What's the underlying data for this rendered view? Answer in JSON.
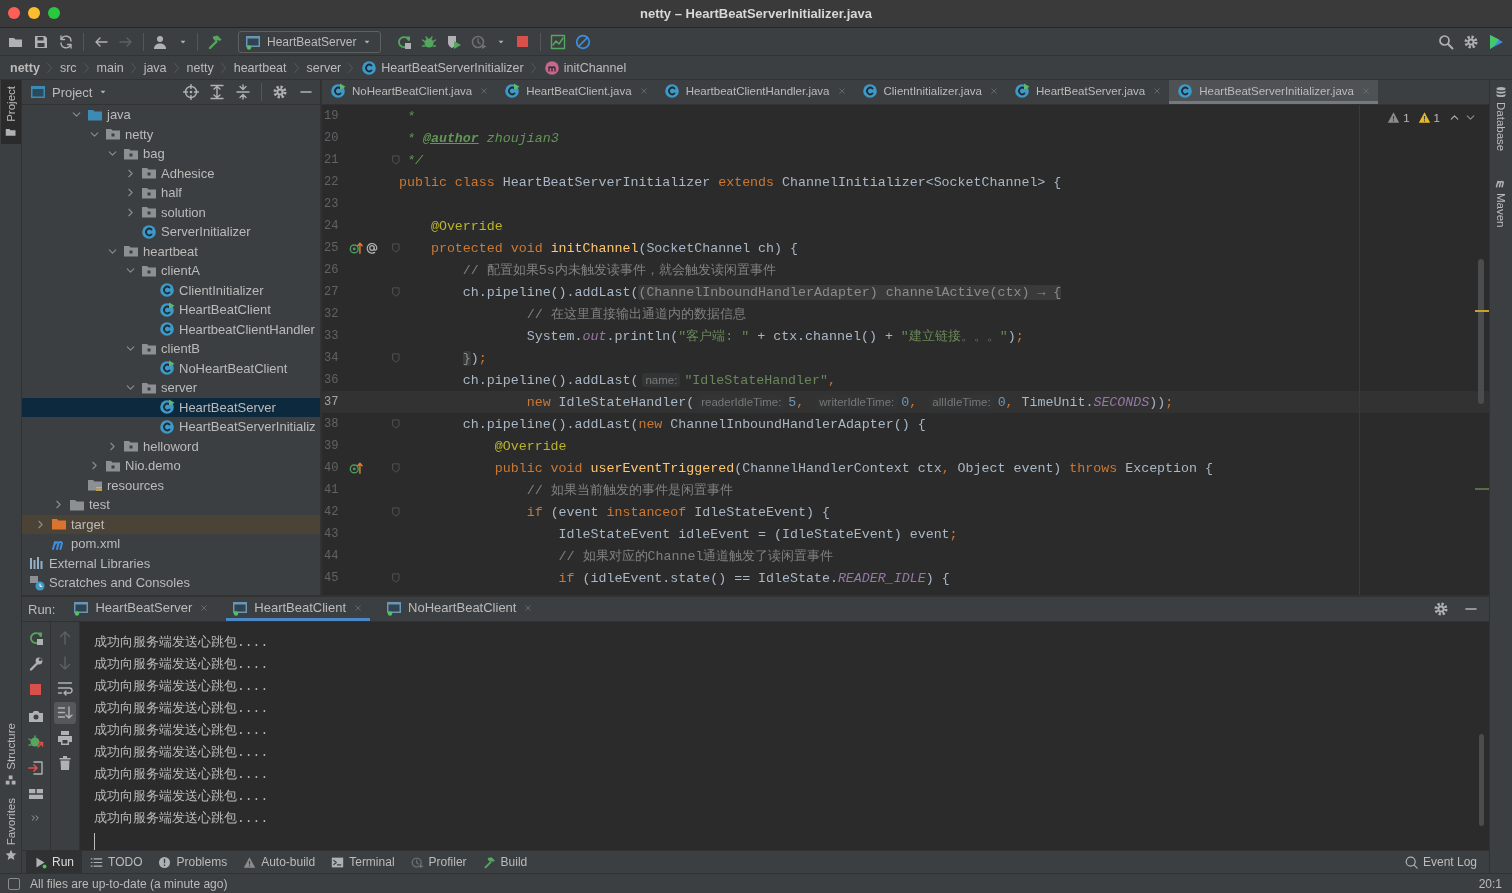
{
  "window": {
    "title": "netty – HeartBeatServerInitializer.java"
  },
  "toolbar": {
    "run_config": "HeartBeatServer"
  },
  "breadcrumbs": [
    {
      "label": "netty",
      "kind": "project"
    },
    {
      "label": "src",
      "kind": "folder"
    },
    {
      "label": "main",
      "kind": "folder"
    },
    {
      "label": "java",
      "kind": "folder"
    },
    {
      "label": "netty",
      "kind": "folder"
    },
    {
      "label": "heartbeat",
      "kind": "folder"
    },
    {
      "label": "server",
      "kind": "folder"
    },
    {
      "label": "HeartBeatServerInitializer",
      "kind": "class"
    },
    {
      "label": "initChannel",
      "kind": "method"
    }
  ],
  "left_stripe": [
    {
      "label": "Project",
      "kind": "project",
      "selected": true
    },
    {
      "label": "Structure",
      "kind": "structure",
      "selected": false
    },
    {
      "label": "Favorites",
      "kind": "favorites",
      "selected": false
    }
  ],
  "right_stripe": [
    {
      "label": "Database",
      "kind": "database"
    },
    {
      "label": "Maven",
      "kind": "maven"
    }
  ],
  "project_panel": {
    "title": "Project",
    "tree": [
      {
        "children": [
          {
            "children": [
              {
                "children": [
                  {
                    "label": "java",
                    "kind": "source-folder",
                    "expanded": true,
                    "selected": false,
                    "children": [
                      {
                        "label": "netty",
                        "kind": "package",
                        "expanded": true,
                        "selected": false,
                        "children": [
                          {
                            "label": "bag",
                            "kind": "package",
                            "expanded": true,
                            "selected": false,
                            "children": [
                              {
                                "label": "Adhesice",
                                "kind": "package",
                                "expanded": false,
                                "selected": false
                              },
                              {
                                "label": "half",
                                "kind": "package",
                                "expanded": false,
                                "selected": false
                              },
                              {
                                "label": "solution",
                                "kind": "package",
                                "expanded": false,
                                "selected": false
                              },
                              {
                                "label": "ServerInitializer",
                                "kind": "class",
                                "selected": false
                              }
                            ]
                          },
                          {
                            "label": "heartbeat",
                            "kind": "package",
                            "expanded": true,
                            "selected": false,
                            "children": [
                              {
                                "label": "clientA",
                                "kind": "package",
                                "expanded": true,
                                "selected": false,
                                "children": [
                                  {
                                    "label": "ClientInitializer",
                                    "kind": "class",
                                    "selected": false
                                  },
                                  {
                                    "label": "HeartBeatClient",
                                    "kind": "runnable-class",
                                    "selected": false
                                  },
                                  {
                                    "label": "HeartbeatClientHandler",
                                    "kind": "class",
                                    "selected": false
                                  }
                                ]
                              },
                              {
                                "label": "clientB",
                                "kind": "package",
                                "expanded": true,
                                "selected": false,
                                "children": [
                                  {
                                    "label": "NoHeartBeatClient",
                                    "kind": "runnable-class",
                                    "selected": false
                                  }
                                ]
                              },
                              {
                                "label": "server",
                                "kind": "package",
                                "expanded": true,
                                "selected": false,
                                "children": [
                                  {
                                    "label": "HeartBeatServer",
                                    "kind": "runnable-class",
                                    "selected": true
                                  },
                                  {
                                    "label": "HeartBeatServerInitializ",
                                    "kind": "class",
                                    "selected": false
                                  }
                                ]
                              }
                            ]
                          },
                          {
                            "label": "helloword",
                            "kind": "package",
                            "expanded": false,
                            "selected": false
                          }
                        ]
                      },
                      {
                        "label": "Nio.demo",
                        "kind": "package",
                        "expanded": false,
                        "selected": false
                      }
                    ]
                  },
                  {
                    "label": "resources",
                    "kind": "resources",
                    "selected": false
                  }
                ]
              },
              {
                "label": "test",
                "kind": "folder",
                "expanded": false,
                "selected": false
              }
            ]
          },
          {
            "label": "target",
            "kind": "excluded-folder",
            "expanded": false,
            "selected": false
          },
          {
            "label": "pom.xml",
            "kind": "maven",
            "selected": false
          }
        ]
      },
      {
        "label": "External Libraries",
        "kind": "libraries",
        "selected": false
      },
      {
        "label": "Scratches and Consoles",
        "kind": "scratches",
        "selected": false
      }
    ]
  },
  "editor": {
    "tabs": [
      {
        "label": "NoHeartBeatClient.java",
        "kind": "runnable-class",
        "selected": false
      },
      {
        "label": "HeartBeatClient.java",
        "kind": "runnable-class",
        "selected": false
      },
      {
        "label": "HeartbeatClientHandler.java",
        "kind": "class",
        "selected": false
      },
      {
        "label": "ClientInitializer.java",
        "kind": "class",
        "selected": false
      },
      {
        "label": "HeartBeatServer.java",
        "kind": "runnable-class",
        "selected": false
      },
      {
        "label": "HeartBeatServerInitializer.java",
        "kind": "class",
        "selected": true
      }
    ],
    "inspections": [
      {
        "kind": "weak-warning",
        "count": "1"
      },
      {
        "kind": "warning",
        "count": "1"
      }
    ],
    "lines": [
      {
        "number": "19",
        "current": false,
        "fold": false,
        "tokens": [
          {
            "kind": "doc",
            "text": " *"
          }
        ]
      },
      {
        "number": "20",
        "current": false,
        "fold": false,
        "tokens": [
          {
            "kind": "doc",
            "text": " * "
          },
          {
            "kind": "doctag",
            "text": "@author"
          },
          {
            "kind": "doc",
            "text": " zhoujian3"
          }
        ]
      },
      {
        "number": "21",
        "current": false,
        "fold": true,
        "tokens": [
          {
            "kind": "doc",
            "text": " */"
          }
        ]
      },
      {
        "number": "22",
        "current": false,
        "fold": false,
        "tokens": [
          {
            "kind": "keyword",
            "text": "public class "
          },
          {
            "kind": "plain",
            "text": "HeartBeatServerInitializer "
          },
          {
            "kind": "keyword",
            "text": "extends "
          },
          {
            "kind": "plain",
            "text": "ChannelInitializer<SocketChannel> {"
          }
        ]
      },
      {
        "number": "23",
        "current": false,
        "fold": false
      },
      {
        "number": "24",
        "current": false,
        "fold": false,
        "tokens": [
          {
            "kind": "annotation",
            "text": "    @Override"
          }
        ]
      },
      {
        "number": "25",
        "current": false,
        "fold": true,
        "overrides": true,
        "annotated": true,
        "tokens": [
          {
            "kind": "keyword",
            "text": "    protected void "
          },
          {
            "kind": "method",
            "text": "initChannel"
          },
          {
            "kind": "plain",
            "text": "(SocketChannel ch) {"
          }
        ]
      },
      {
        "number": "26",
        "current": false,
        "fold": false,
        "tokens": [
          {
            "kind": "comment",
            "text": "        // 配置如果5s内未触发读事件，就会触发读闲置事件"
          }
        ]
      },
      {
        "number": "27",
        "current": false,
        "fold": true,
        "tokens": [
          {
            "kind": "plain",
            "text": "        ch.pipeline().addLast("
          },
          {
            "kind": "folded",
            "text": "(ChannelInboundHandlerAdapter) channelActive(ctx) → {"
          }
        ]
      },
      {
        "number": "32",
        "current": false,
        "fold": false,
        "tokens": [
          {
            "kind": "comment",
            "text": "                // 在这里直接输出通道内的数据信息"
          }
        ]
      },
      {
        "number": "33",
        "current": false,
        "fold": false,
        "tokens": [
          {
            "kind": "plain",
            "text": "                System."
          },
          {
            "kind": "static",
            "text": "out"
          },
          {
            "kind": "plain",
            "text": ".println("
          },
          {
            "kind": "string",
            "text": "\"客户端: \""
          },
          {
            "kind": "plain",
            "text": " + ctx.channel() + "
          },
          {
            "kind": "string",
            "text": "\"建立链接。。。\""
          },
          {
            "kind": "plain",
            "text": ")"
          },
          {
            "kind": "keyword",
            "text": ";"
          }
        ]
      },
      {
        "number": "34",
        "current": false,
        "fold": true,
        "tokens": [
          {
            "kind": "folded",
            "text": "        }"
          },
          {
            "kind": "plain",
            "text": ")"
          },
          {
            "kind": "keyword",
            "text": ";"
          }
        ]
      },
      {
        "number": "36",
        "current": false,
        "fold": false,
        "tokens": [
          {
            "kind": "plain",
            "text": "        ch.pipeline().addLast("
          },
          {
            "kind": "hint",
            "text": "name:"
          },
          {
            "kind": "string",
            "text": "\"IdleStateHandler\""
          },
          {
            "kind": "keyword",
            "text": ","
          }
        ]
      },
      {
        "number": "37",
        "current": true,
        "fold": false,
        "tokens": [
          {
            "kind": "keyword",
            "text": "                new "
          },
          {
            "kind": "plain",
            "text": "IdleStateHandler("
          },
          {
            "kind": "hint",
            "text": "readerIdleTime:"
          },
          {
            "kind": "number",
            "text": "5"
          },
          {
            "kind": "keyword",
            "text": ", "
          },
          {
            "kind": "hint",
            "text": "writerIdleTime:"
          },
          {
            "kind": "number",
            "text": "0"
          },
          {
            "kind": "keyword",
            "text": ", "
          },
          {
            "kind": "hint",
            "text": "allIdleTime:"
          },
          {
            "kind": "number",
            "text": "0"
          },
          {
            "kind": "keyword",
            "text": ", "
          },
          {
            "kind": "plain",
            "text": "TimeUnit."
          },
          {
            "kind": "static",
            "text": "SECONDS"
          },
          {
            "kind": "plain",
            "text": "))"
          },
          {
            "kind": "keyword",
            "text": ";"
          }
        ]
      },
      {
        "number": "38",
        "current": false,
        "fold": true,
        "tokens": [
          {
            "kind": "plain",
            "text": "        ch.pipeline().addLast("
          },
          {
            "kind": "keyword",
            "text": "new "
          },
          {
            "kind": "plain",
            "text": "ChannelInboundHandlerAdapter() {"
          }
        ]
      },
      {
        "number": "39",
        "current": false,
        "fold": false,
        "tokens": [
          {
            "kind": "annotation",
            "text": "            @Override"
          }
        ]
      },
      {
        "number": "40",
        "current": false,
        "fold": true,
        "overrides": true,
        "annotated": false,
        "tokens": [
          {
            "kind": "keyword",
            "text": "            public void "
          },
          {
            "kind": "method",
            "text": "userEventTriggered"
          },
          {
            "kind": "plain",
            "text": "(ChannelHandlerContext ctx"
          },
          {
            "kind": "keyword",
            "text": ", "
          },
          {
            "kind": "plain",
            "text": "Object event) "
          },
          {
            "kind": "keyword",
            "text": "throws "
          },
          {
            "kind": "plain",
            "text": "Exception {"
          }
        ]
      },
      {
        "number": "41",
        "current": false,
        "fold": false,
        "tokens": [
          {
            "kind": "comment",
            "text": "                // 如果当前触发的事件是闲置事件"
          }
        ]
      },
      {
        "number": "42",
        "current": false,
        "fold": true,
        "tokens": [
          {
            "kind": "keyword",
            "text": "                if "
          },
          {
            "kind": "plain",
            "text": "(event "
          },
          {
            "kind": "keyword",
            "text": "instanceof "
          },
          {
            "kind": "plain",
            "text": "IdleStateEvent) {"
          }
        ]
      },
      {
        "number": "43",
        "current": false,
        "fold": false,
        "tokens": [
          {
            "kind": "plain",
            "text": "                    IdleStateEvent idleEvent = (IdleStateEvent) event"
          },
          {
            "kind": "keyword",
            "text": ";"
          }
        ]
      },
      {
        "number": "44",
        "current": false,
        "fold": false,
        "tokens": [
          {
            "kind": "comment",
            "text": "                    // 如果对应的Channel通道触发了读闲置事件"
          }
        ]
      },
      {
        "number": "45",
        "current": false,
        "fold": true,
        "tokens": [
          {
            "kind": "keyword",
            "text": "                    if "
          },
          {
            "kind": "plain",
            "text": "(idleEvent.state() == IdleState."
          },
          {
            "kind": "static",
            "text": "READER_IDLE"
          },
          {
            "kind": "plain",
            "text": ") {"
          }
        ]
      }
    ]
  },
  "run_panel": {
    "label": "Run:",
    "tabs": [
      {
        "label": "HeartBeatServer",
        "selected": false
      },
      {
        "label": "HeartBeatClient",
        "selected": true
      },
      {
        "label": "NoHeartBeatClient",
        "selected": false
      }
    ],
    "console": [
      "成功向服务端发送心跳包....",
      "成功向服务端发送心跳包....",
      "成功向服务端发送心跳包....",
      "成功向服务端发送心跳包....",
      "成功向服务端发送心跳包....",
      "成功向服务端发送心跳包....",
      "成功向服务端发送心跳包....",
      "成功向服务端发送心跳包....",
      "成功向服务端发送心跳包...."
    ]
  },
  "tool_tabs": [
    {
      "label": "Run",
      "kind": "run",
      "selected": true
    },
    {
      "label": "TODO",
      "kind": "list",
      "selected": false
    },
    {
      "label": "Problems",
      "kind": "problems",
      "selected": false
    },
    {
      "label": "Auto-build",
      "kind": "warning",
      "selected": false
    },
    {
      "label": "Terminal",
      "kind": "terminal",
      "selected": false
    },
    {
      "label": "Profiler",
      "kind": "profiler",
      "selected": false
    },
    {
      "label": "Build",
      "kind": "hammer",
      "selected": false
    }
  ],
  "event_log": "Event Log",
  "status_bar": {
    "message": "All files are up-to-date (a minute ago)",
    "position": "20:1"
  }
}
